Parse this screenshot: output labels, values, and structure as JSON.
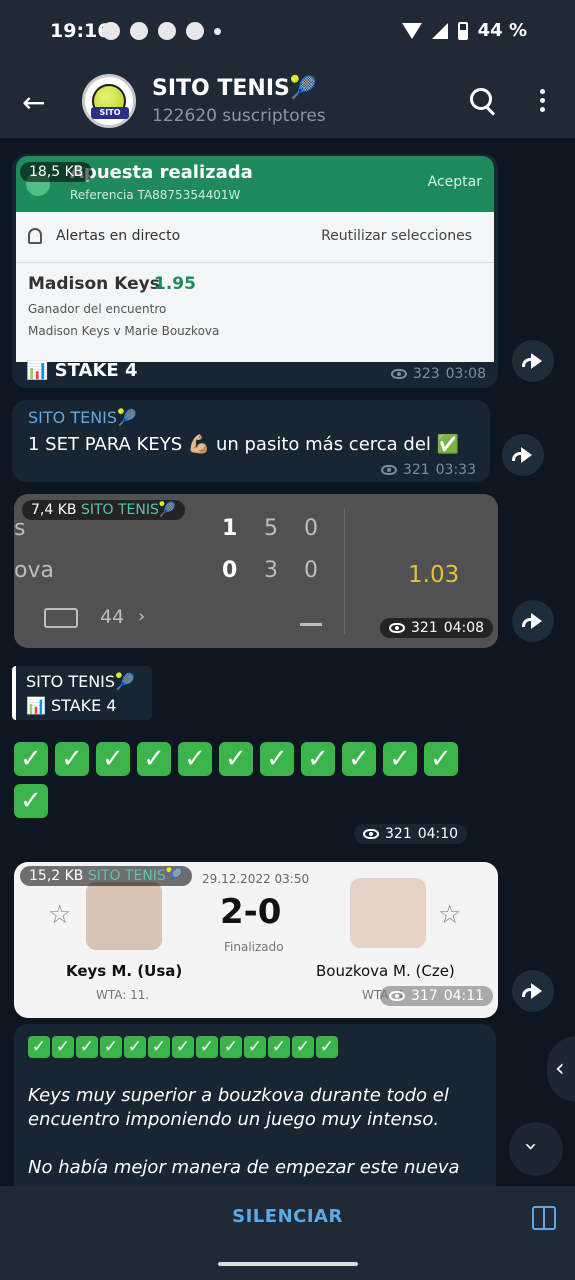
{
  "status": {
    "time": "19:16",
    "battery": "44 %"
  },
  "header": {
    "title": "SITO TENIS🎾",
    "subtitle": "122620 suscriptores",
    "avatar_text": "SITO"
  },
  "messages": {
    "m1": {
      "size_badge": "18,5 KB",
      "bet_title": "Apuesta realizada",
      "reference": "Referencia TA8875354401W",
      "accept": "Aceptar",
      "alerts": "Alertas en directo",
      "reuse": "Reutilizar selecciones",
      "player": "Madison Keys",
      "odds": "1.95",
      "market": "Ganador del encuentro",
      "match": "Madison Keys v Marie Bouzkova",
      "caption": "📊 STAKE 4",
      "views": "323",
      "time": "03:08"
    },
    "m2": {
      "author": "SITO TENIS🎾",
      "text": "1 SET PARA KEYS 💪🏼 un pasito más cerca del ✅",
      "views": "321",
      "time": "03:33"
    },
    "m3": {
      "size_badge": "7,4 KB",
      "author": "SITO TENIS🎾",
      "row1_name": "s",
      "row1_scores": [
        "1",
        "5",
        "0"
      ],
      "row2_name": "ova",
      "row2_scores": [
        "0",
        "3",
        "0"
      ],
      "count": "44",
      "odds": "1.03",
      "views": "321",
      "time": "04:08"
    },
    "m4": {
      "reply_author": "SITO TENIS🎾",
      "reply_text": "📊 STAKE 4",
      "views": "321",
      "time": "04:10"
    },
    "m5": {
      "size_badge": "15,2 KB",
      "author": "SITO TENIS🎾",
      "datetime": "29.12.2022 03:50",
      "score": "2-0",
      "status": "Finalizado",
      "p1": "Keys M. (Usa)",
      "p1_rank": "WTA: 11.",
      "p2": "Bouzkova M. (Cze)",
      "p2_rank": "WTA: 4",
      "views": "317",
      "time": "04:11"
    },
    "m6": {
      "para1": "Keys muy superior a bouzkova durante todo el encuentro imponiendo un juego muy intenso.",
      "para2": "No había mejor manera de empezar este nueva"
    }
  },
  "footer": {
    "mute": "SILENCIAR"
  }
}
